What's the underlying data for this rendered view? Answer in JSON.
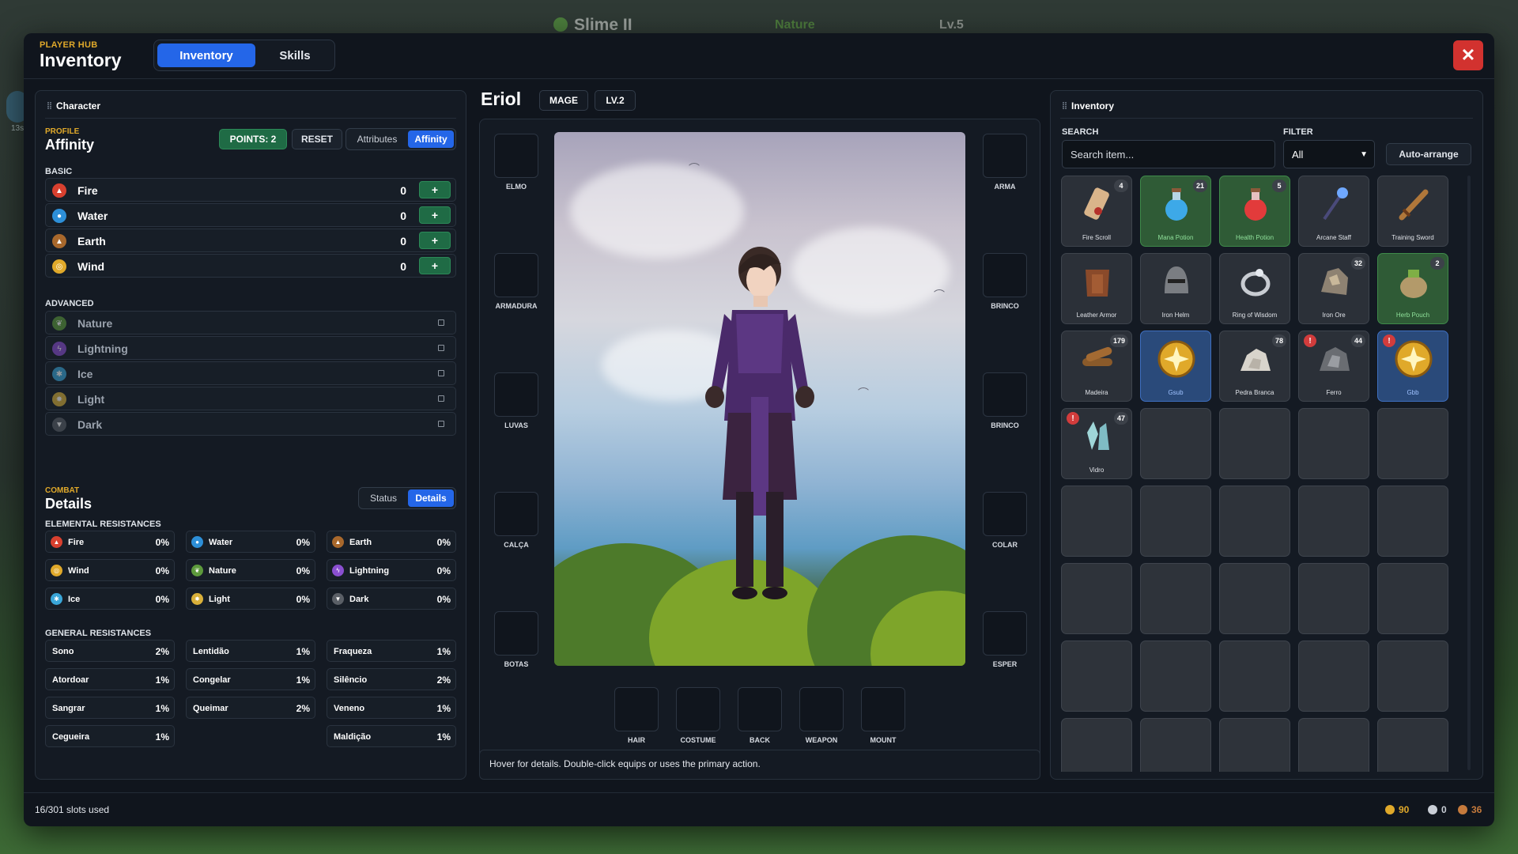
{
  "background_hud": {
    "mob_name": "Slime II",
    "element": "Nature",
    "level": "Lv.5",
    "side_text": "13s"
  },
  "header": {
    "eyebrow": "PLAYER HUB",
    "title": "Inventory",
    "tabs": [
      {
        "label": "Inventory"
      },
      {
        "label": "Skills"
      }
    ],
    "close_label": "✕"
  },
  "character": {
    "panel_title": "Character",
    "profile_eyebrow": "PROFILE",
    "profile_title": "Affinity",
    "points_label": "POINTS: 2",
    "reset_label": "RESET",
    "view_tabs": [
      "Attributes",
      "Affinity"
    ],
    "basic_label": "BASIC",
    "basic": [
      {
        "name": "Fire",
        "value": "0",
        "icon": "flame-icon",
        "color": "#d8402f"
      },
      {
        "name": "Water",
        "value": "0",
        "icon": "water-drop-icon",
        "color": "#2d8fd8"
      },
      {
        "name": "Earth",
        "value": "0",
        "icon": "mountain-icon",
        "color": "#a8682c"
      },
      {
        "name": "Wind",
        "value": "0",
        "icon": "wind-icon",
        "color": "#e0a92a"
      }
    ],
    "plus_label": "+",
    "advanced_label": "ADVANCED",
    "advanced": [
      {
        "name": "Nature",
        "icon": "leaf-icon",
        "color": "#5d9a3c"
      },
      {
        "name": "Lightning",
        "icon": "lightning-icon",
        "color": "#8a4fd0"
      },
      {
        "name": "Ice",
        "icon": "snowflake-icon",
        "color": "#3aa6d8"
      },
      {
        "name": "Light",
        "icon": "sun-icon",
        "color": "#d9b03a"
      },
      {
        "name": "Dark",
        "icon": "dark-wings-icon",
        "color": "#5a5f66"
      }
    ],
    "combat_eyebrow": "COMBAT",
    "combat_title": "Details",
    "combat_tabs": [
      "Status",
      "Details"
    ],
    "elemental_label": "ELEMENTAL RESISTANCES",
    "elemental": [
      {
        "name": "Fire",
        "value": "0%",
        "icon": "flame-icon",
        "color": "#d8402f"
      },
      {
        "name": "Water",
        "value": "0%",
        "icon": "water-drop-icon",
        "color": "#2d8fd8"
      },
      {
        "name": "Earth",
        "value": "0%",
        "icon": "mountain-icon",
        "color": "#a8682c"
      },
      {
        "name": "Wind",
        "value": "0%",
        "icon": "wind-icon",
        "color": "#e0a92a"
      },
      {
        "name": "Nature",
        "value": "0%",
        "icon": "leaf-icon",
        "color": "#5d9a3c"
      },
      {
        "name": "Lightning",
        "value": "0%",
        "icon": "lightning-icon",
        "color": "#8a4fd0"
      },
      {
        "name": "Ice",
        "value": "0%",
        "icon": "snowflake-icon",
        "color": "#3aa6d8"
      },
      {
        "name": "Light",
        "value": "0%",
        "icon": "sun-icon",
        "color": "#d9b03a"
      },
      {
        "name": "Dark",
        "value": "0%",
        "icon": "dark-wings-icon",
        "color": "#5a5f66"
      }
    ],
    "general_label": "GENERAL RESISTANCES",
    "general": [
      {
        "name": "Sono",
        "value": "2%"
      },
      {
        "name": "Lentidão",
        "value": "1%"
      },
      {
        "name": "Fraqueza",
        "value": "1%"
      },
      {
        "name": "Atordoar",
        "value": "1%"
      },
      {
        "name": "Congelar",
        "value": "1%"
      },
      {
        "name": "Silêncio",
        "value": "2%"
      },
      {
        "name": "Sangrar",
        "value": "1%"
      },
      {
        "name": "Queimar",
        "value": "2%"
      },
      {
        "name": "Veneno",
        "value": "1%"
      },
      {
        "name": "Cegueira",
        "value": "1%"
      },
      {
        "name": "Maldição",
        "value": "1%"
      }
    ]
  },
  "equipment": {
    "name": "Eriol",
    "class": "MAGE",
    "level": "LV.2",
    "left_slots": [
      "ELMO",
      "ARMADURA",
      "LUVAS",
      "CALÇA",
      "BOTAS"
    ],
    "right_slots": [
      "ARMA",
      "BRINCO",
      "BRINCO",
      "COLAR",
      "ESPER"
    ],
    "bottom_slots": [
      "HAIR",
      "COSTUME",
      "BACK",
      "WEAPON",
      "MOUNT"
    ],
    "hint": "Hover for details. Double-click equips or uses the primary action."
  },
  "inventory": {
    "panel_title": "Inventory",
    "search_label": "SEARCH",
    "search_placeholder": "Search item...",
    "filter_label": "FILTER",
    "filter_value": "All",
    "auto_arrange_label": "Auto-arrange",
    "items": [
      {
        "name": "Fire Scroll",
        "count": "4",
        "icon": "scroll-icon",
        "style": "normal"
      },
      {
        "name": "Mana Potion",
        "count": "21",
        "icon": "mana-potion-icon",
        "style": "green"
      },
      {
        "name": "Health Potion",
        "count": "5",
        "icon": "health-potion-icon",
        "style": "green"
      },
      {
        "name": "Arcane Staff",
        "count": "",
        "icon": "staff-icon",
        "style": "normal"
      },
      {
        "name": "Training Sword",
        "count": "",
        "icon": "sword-icon",
        "style": "normal"
      },
      {
        "name": "Leather Armor",
        "count": "",
        "icon": "armor-icon",
        "style": "normal"
      },
      {
        "name": "Iron Helm",
        "count": "",
        "icon": "helmet-icon",
        "style": "normal"
      },
      {
        "name": "Ring of Wisdom",
        "count": "",
        "icon": "ring-icon",
        "style": "normal"
      },
      {
        "name": "Iron Ore",
        "count": "32",
        "icon": "ore-icon",
        "style": "normal"
      },
      {
        "name": "Herb Pouch",
        "count": "2",
        "icon": "pouch-icon",
        "style": "green"
      },
      {
        "name": "Madeira",
        "count": "179",
        "icon": "wood-logs-icon",
        "style": "normal"
      },
      {
        "name": "Gsub",
        "count": "",
        "icon": "gold-coin-icon",
        "style": "blue"
      },
      {
        "name": "Pedra Branca",
        "count": "78",
        "icon": "white-stone-icon",
        "style": "normal"
      },
      {
        "name": "Ferro",
        "count": "44",
        "icon": "iron-chunk-icon",
        "style": "normal",
        "warn": true
      },
      {
        "name": "Gbb",
        "count": "",
        "icon": "gold-coin-icon",
        "style": "blue",
        "warn": true
      },
      {
        "name": "Vidro",
        "count": "47",
        "icon": "crystal-icon",
        "style": "normal",
        "warn": true
      }
    ],
    "warn_mark": "!",
    "total_slots": 40
  },
  "footer": {
    "slots_used": "16/301 slots used",
    "currencies": [
      {
        "value": "90",
        "color": "#e0a92a",
        "icon": "gold-dot-icon"
      },
      {
        "value": "0",
        "color": "#c9ced6",
        "icon": "silver-dot-icon"
      },
      {
        "value": "36",
        "color": "#c57a3c",
        "icon": "bronze-dot-icon"
      }
    ]
  }
}
